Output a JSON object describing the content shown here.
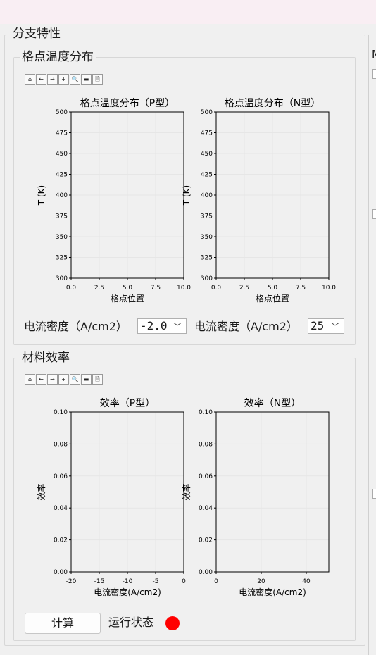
{
  "section_title": "分支特性",
  "right_panel_letter": "M",
  "toolbar_icons": [
    {
      "name": "home-icon",
      "glyph": "⌂"
    },
    {
      "name": "back-icon",
      "glyph": "←"
    },
    {
      "name": "forward-icon",
      "glyph": "→"
    },
    {
      "name": "pan-icon",
      "glyph": "+"
    },
    {
      "name": "zoom-icon",
      "glyph": "🔍"
    },
    {
      "name": "configure-icon",
      "glyph": "▬"
    },
    {
      "name": "save-icon",
      "glyph": "🗎"
    }
  ],
  "temp_group": {
    "title": "格点温度分布",
    "current_label_p": "电流密度（A/cm2）",
    "current_value_p": "-2.0",
    "current_label_n": "电流密度（A/cm2）",
    "current_value_n": "25"
  },
  "eff_group": {
    "title": "材料效率",
    "calc_button": "计算",
    "status_label": "运行状态",
    "status_color": "#ff0000"
  },
  "chart_data": [
    {
      "type": "line",
      "title": "格点温度分布（P型）",
      "xlabel": "格点位置",
      "ylabel": "T (K)",
      "xlim": [
        0,
        10
      ],
      "ylim": [
        300,
        500
      ],
      "xticks": [
        "0.0",
        "2.5",
        "5.0",
        "7.5",
        "10.0"
      ],
      "yticks": [
        "300",
        "325",
        "350",
        "375",
        "400",
        "425",
        "450",
        "475",
        "500"
      ],
      "grid": true,
      "series": []
    },
    {
      "type": "line",
      "title": "格点温度分布（N型）",
      "xlabel": "格点位置",
      "ylabel": "T (K)",
      "xlim": [
        0,
        10
      ],
      "ylim": [
        300,
        500
      ],
      "xticks": [
        "0.0",
        "2.5",
        "5.0",
        "7.5",
        "10.0"
      ],
      "yticks": [
        "300",
        "325",
        "350",
        "375",
        "400",
        "425",
        "450",
        "475",
        "500"
      ],
      "grid": true,
      "series": []
    },
    {
      "type": "line",
      "title": "效率（P型）",
      "xlabel": "电流密度(A/cm2)",
      "ylabel": "效率",
      "xlim": [
        -20,
        0
      ],
      "ylim": [
        0,
        0.1
      ],
      "xticks": [
        "-20",
        "-15",
        "-10",
        "-5",
        "0"
      ],
      "yticks": [
        "0.00",
        "0.02",
        "0.04",
        "0.06",
        "0.08",
        "0.10"
      ],
      "grid": true,
      "series": []
    },
    {
      "type": "line",
      "title": "效率（N型）",
      "xlabel": "电流密度(A/cm2)",
      "ylabel": "效率",
      "xlim": [
        0,
        50
      ],
      "ylim": [
        0,
        0.1
      ],
      "xticks": [
        "0",
        "20",
        "40"
      ],
      "xtick_values": [
        0,
        20,
        40
      ],
      "yticks": [
        "0.00",
        "0.02",
        "0.04",
        "0.06",
        "0.08",
        "0.10"
      ],
      "grid": true,
      "series": []
    }
  ]
}
